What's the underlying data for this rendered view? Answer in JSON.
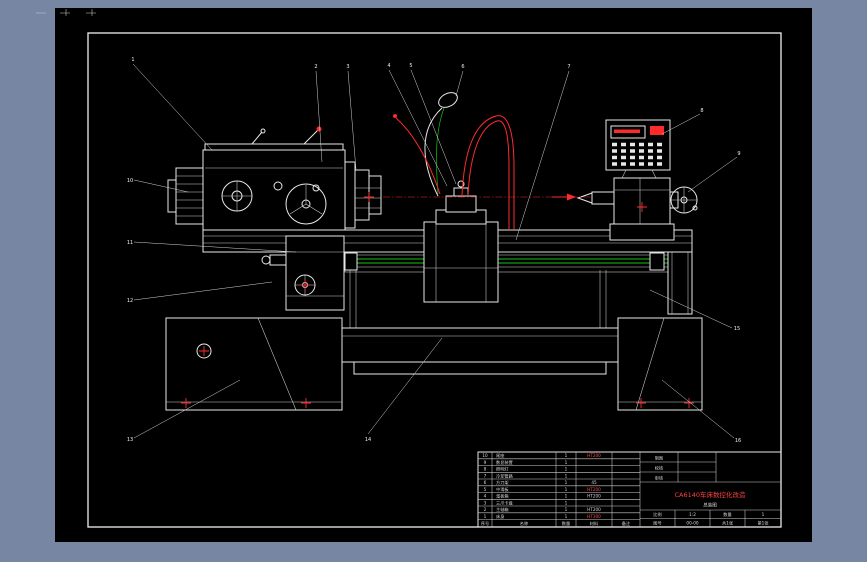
{
  "viewer": {
    "background": "#7787a3",
    "sheet_color": "#000000",
    "line_color": "#e9e9e9",
    "accent_red": "#ff2b2b",
    "accent_green": "#12c212"
  },
  "callouts": [
    {
      "label": "1"
    },
    {
      "label": "2"
    },
    {
      "label": "3"
    },
    {
      "label": "4"
    },
    {
      "label": "5"
    },
    {
      "label": "6"
    },
    {
      "label": "7"
    },
    {
      "label": "8"
    },
    {
      "label": "9"
    },
    {
      "label": "10"
    },
    {
      "label": "11"
    },
    {
      "label": "12"
    },
    {
      "label": "13"
    },
    {
      "label": "14"
    },
    {
      "label": "15"
    },
    {
      "label": "16"
    }
  ],
  "title_block": {
    "bom_headers": {
      "no": "序号",
      "name": "名称",
      "qty": "数量",
      "material": "材料",
      "remark": "备注"
    },
    "bom_rows": [
      {
        "no": "10",
        "name": "尾座",
        "qty": "1",
        "material": "HT200"
      },
      {
        "no": "9",
        "name": "数显装置",
        "qty": "1",
        "material": ""
      },
      {
        "no": "8",
        "name": "照明灯",
        "qty": "1",
        "material": ""
      },
      {
        "no": "7",
        "name": "冷却管路",
        "qty": "1",
        "material": ""
      },
      {
        "no": "6",
        "name": "方刀架",
        "qty": "1",
        "material": "45"
      },
      {
        "no": "5",
        "name": "中滑板",
        "qty": "1",
        "material": "HT200"
      },
      {
        "no": "4",
        "name": "溜板箱",
        "qty": "1",
        "material": "HT200"
      },
      {
        "no": "3",
        "name": "三爪卡盘",
        "qty": "1",
        "material": ""
      },
      {
        "no": "2",
        "name": "主轴箱",
        "qty": "1",
        "material": "HT200"
      },
      {
        "no": "1",
        "name": "床身",
        "qty": "1",
        "material": "HT300"
      }
    ],
    "sign_rows": [
      {
        "label": "制图"
      },
      {
        "label": "校核"
      },
      {
        "label": "审核"
      }
    ],
    "main_title": "CA6140车床数控化改造",
    "sub_title": "总装图",
    "info": {
      "scale_label": "比例",
      "scale": "1:2",
      "qty_label": "数量",
      "qty": "1",
      "no_label": "图号",
      "drawing_no": "00-00",
      "sheet_total": "共1张",
      "sheet_page": "第1张"
    }
  }
}
